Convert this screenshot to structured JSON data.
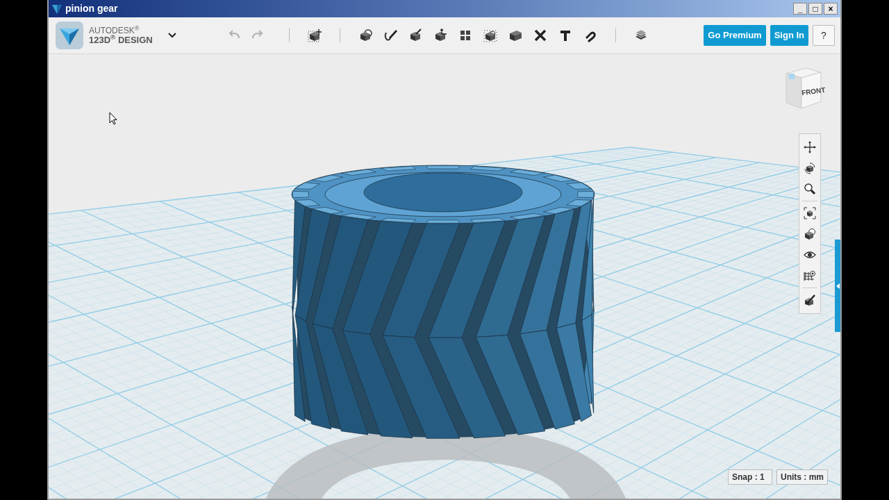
{
  "window": {
    "title": "pinion gear",
    "controls": [
      "_",
      "□",
      "×"
    ]
  },
  "brand": {
    "line1": "AUTODESK$^{®}$",
    "line2": "123D$^{®}$ DESIGN"
  },
  "toolbar": [
    {
      "kind": "undo",
      "disabled": true
    },
    {
      "kind": "redo",
      "disabled": true
    },
    {
      "kind": "sep"
    },
    {
      "kind": "transform",
      "disabled": false
    },
    {
      "kind": "sep"
    },
    {
      "kind": "primitives",
      "disabled": false
    },
    {
      "kind": "sketch",
      "disabled": false
    },
    {
      "kind": "construct",
      "disabled": false
    },
    {
      "kind": "modify",
      "disabled": false
    },
    {
      "kind": "pattern",
      "disabled": false
    },
    {
      "kind": "group",
      "disabled": false
    },
    {
      "kind": "combine",
      "disabled": false
    },
    {
      "kind": "measure",
      "disabled": false
    },
    {
      "kind": "text",
      "disabled": false
    },
    {
      "kind": "snap",
      "disabled": false
    },
    {
      "kind": "sep"
    },
    {
      "kind": "materials",
      "disabled": false
    }
  ],
  "buttons": [
    {
      "label": "Go Premium",
      "kind": "primary"
    },
    {
      "label": "Sign In",
      "kind": "primary"
    },
    {
      "label": "?",
      "kind": "plain"
    }
  ],
  "view_cube": {
    "face": "FRONT"
  },
  "nav_toolbar": [
    {
      "kind": "pan"
    },
    {
      "kind": "orbit"
    },
    {
      "kind": "zoom"
    },
    {
      "kind": "sep"
    },
    {
      "kind": "fit"
    },
    {
      "kind": "solid"
    },
    {
      "kind": "visibility"
    },
    {
      "kind": "grid"
    },
    {
      "kind": "sep"
    },
    {
      "kind": "settings"
    }
  ],
  "status_bar": {
    "snap": "Snap : 1",
    "units": "Units : mm"
  }
}
